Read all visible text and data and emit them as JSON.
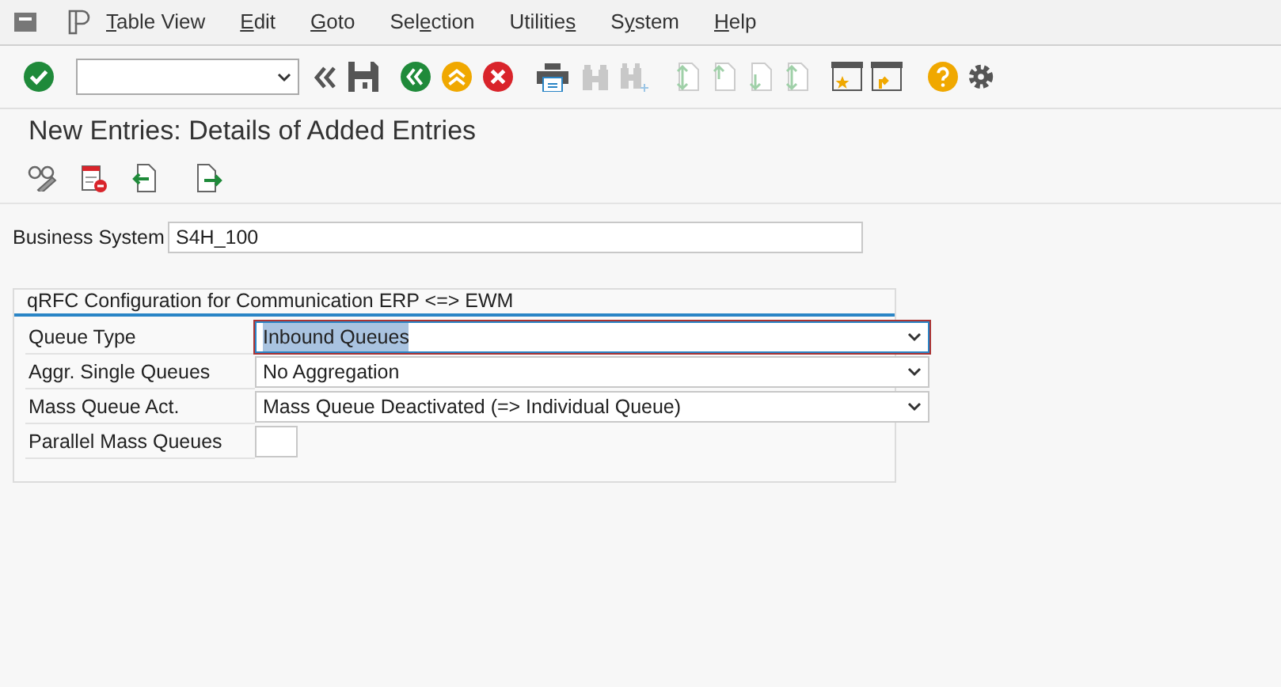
{
  "menu_bar": {
    "items": [
      {
        "mnemonic": "T",
        "after": "able View"
      },
      {
        "mnemonic": "E",
        "after": "dit"
      },
      {
        "mnemonic": "G",
        "after": "oto"
      },
      {
        "before": "Sel",
        "mnemonic": "e",
        "after": "ction"
      },
      {
        "before": "Utilitie",
        "mnemonic": "s"
      },
      {
        "before": "S",
        "mnemonic": "y",
        "after": "stem"
      },
      {
        "mnemonic": "H",
        "after": "elp"
      }
    ]
  },
  "screen_title": "New Entries: Details of Added Entries",
  "business_system": {
    "label": "Business System",
    "value": "S4H_100"
  },
  "group": {
    "title": "qRFC Configuration for Communication ERP <=> EWM",
    "fields": [
      {
        "label": "Queue Type",
        "kind": "dropdown",
        "value": "Inbound Queues",
        "focused": true
      },
      {
        "label": "Aggr. Single Queues",
        "kind": "dropdown",
        "value": "No Aggregation",
        "focused": false
      },
      {
        "label": "Mass Queue Act.",
        "kind": "dropdown",
        "value": "Mass Queue Deactivated (=> Individual Queue)",
        "focused": false
      },
      {
        "label": "Parallel Mass Queues",
        "kind": "input",
        "focused": false
      }
    ]
  }
}
